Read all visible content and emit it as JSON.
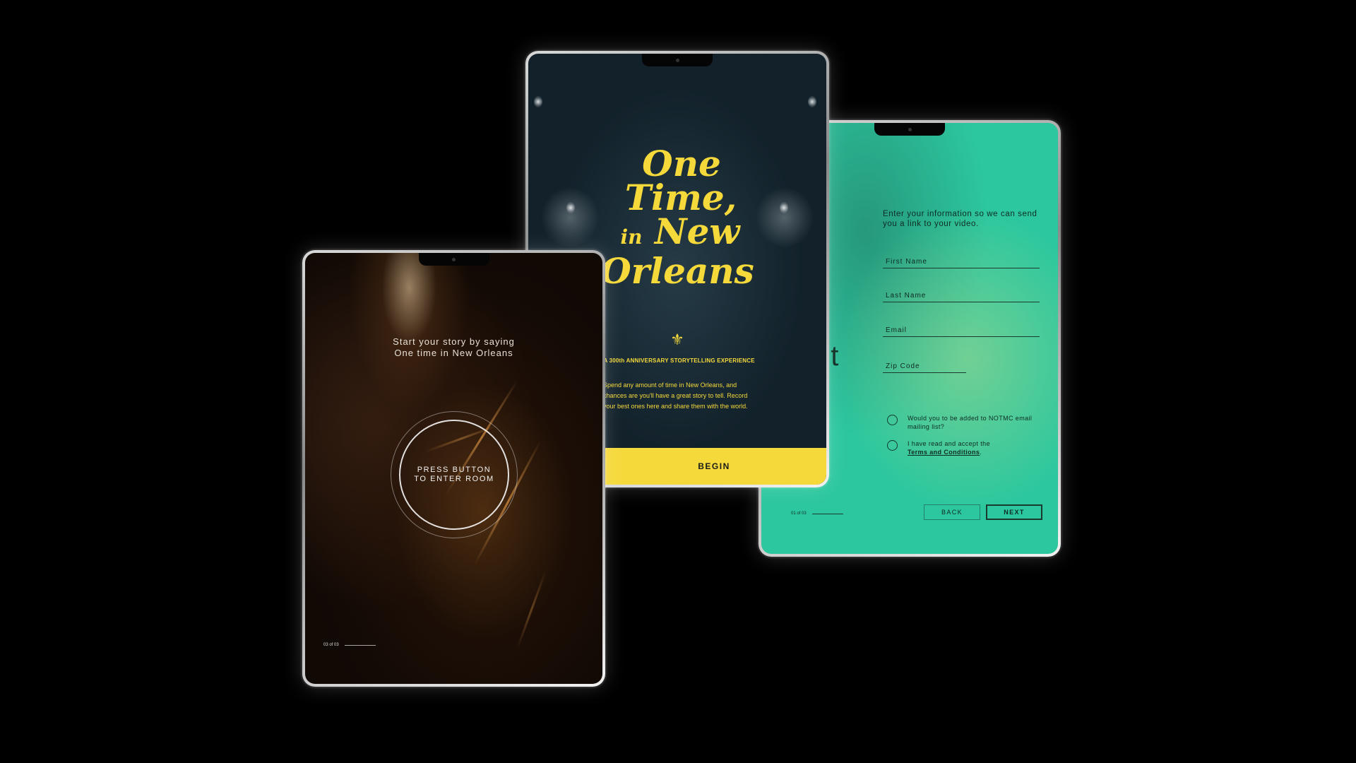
{
  "left_screen": {
    "prompt_line1": "Start your story by saying",
    "prompt_line2": "One time in New Orleans",
    "record_button_label": "PRESS BUTTON TO ENTER ROOM",
    "page_indicator": "03 of 03"
  },
  "middle_screen": {
    "title_line1": "One",
    "title_line2": "Time,",
    "title_line3_small": "in",
    "title_line3": "New",
    "title_line4": "Orleans",
    "subtitle": "OLA 300th ANNIVERSARY STORYTELLING EXPERIENCE",
    "intro_text": "Spend any amount of time in New Orleans, and chances are you'll have a great story to tell. Record your best ones here and share them with the world.",
    "begin_button_label": "BEGIN",
    "accent_color": "#f5d93b"
  },
  "right_screen": {
    "ghost_text": "ut",
    "form_intro": "Enter your information so we can send you a link to your video.",
    "fields": {
      "first_name_placeholder": "First Name",
      "last_name_placeholder": "Last Name",
      "email_placeholder": "Email",
      "zip_placeholder": "Zip Code"
    },
    "mailing_list_text": "Would you to be added to NOTMC email mailing list?",
    "terms_prefix": "I have read and accept the",
    "terms_link": "Terms and Conditions",
    "terms_suffix": ".",
    "page_indicator": "01 of 03",
    "back_label": "BACK",
    "next_label": "NEXT",
    "accent_color": "#2cc79e"
  },
  "icons": {
    "fleur_de_lis": "⚜"
  }
}
